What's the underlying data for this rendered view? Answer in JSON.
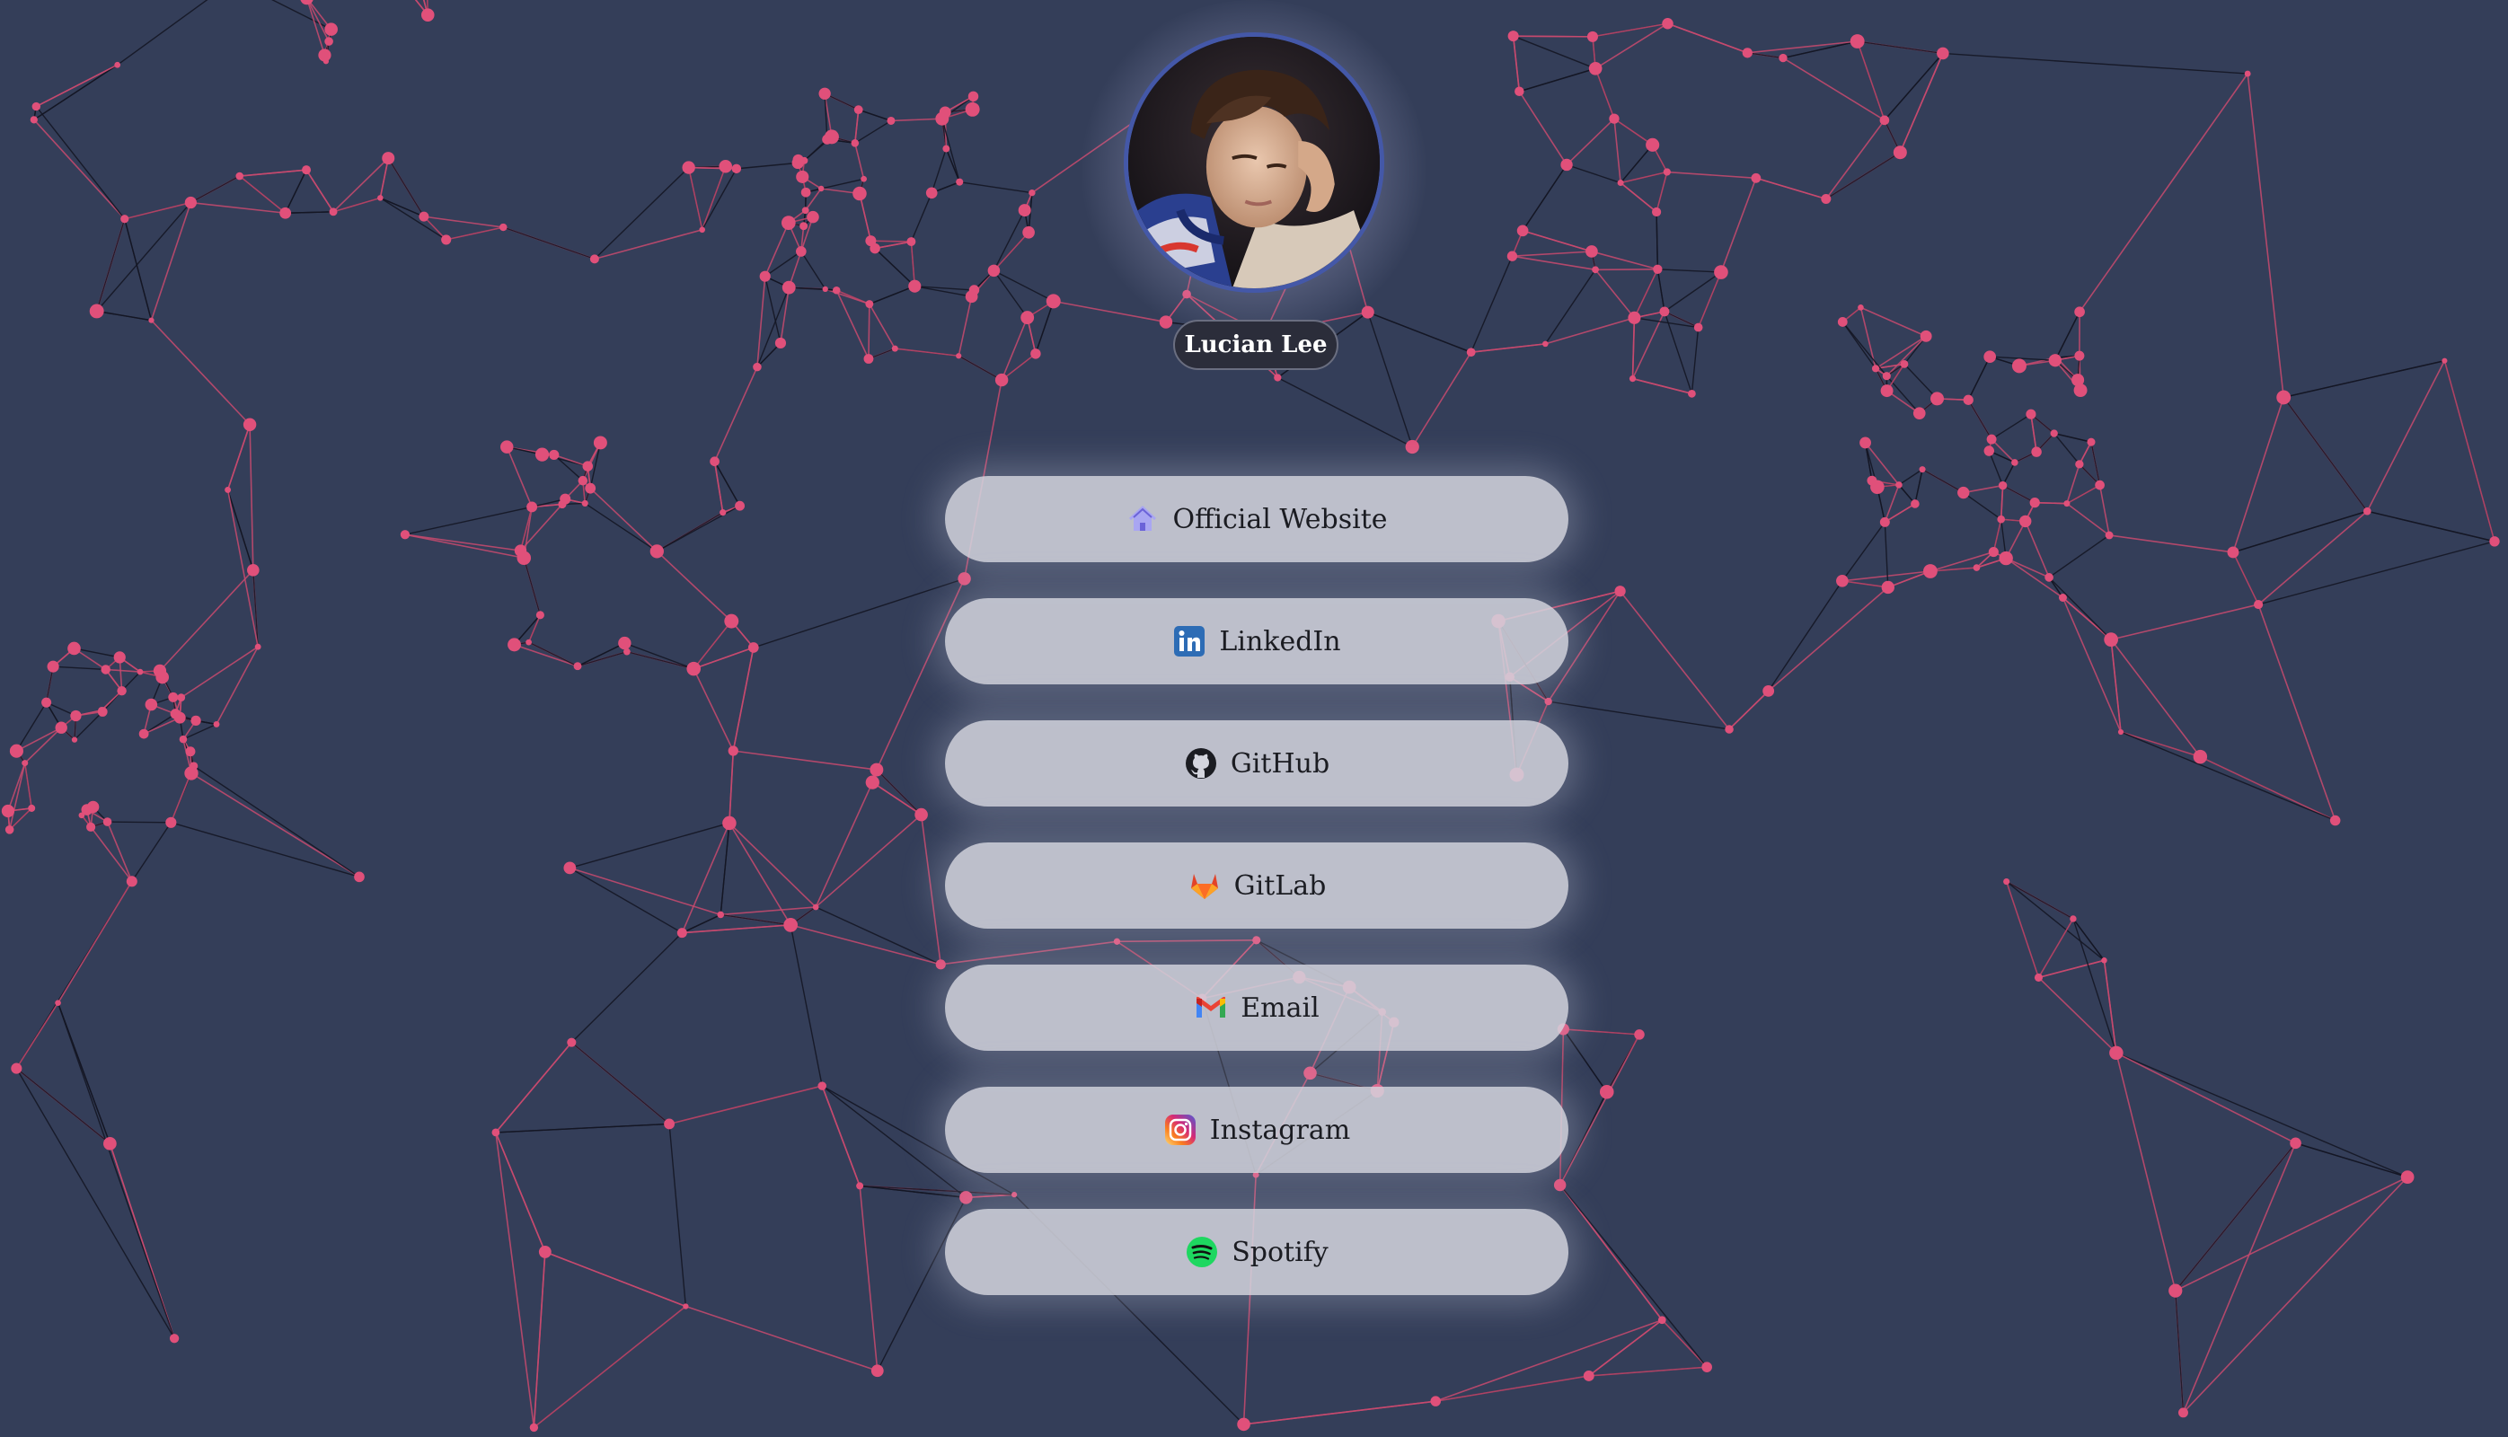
{
  "profile": {
    "name": "Lucian Lee"
  },
  "links": [
    {
      "label": "Official Website",
      "icon": "home-icon"
    },
    {
      "label": "LinkedIn",
      "icon": "linkedin-icon"
    },
    {
      "label": "GitHub",
      "icon": "github-icon"
    },
    {
      "label": "GitLab",
      "icon": "gitlab-icon"
    },
    {
      "label": "Email",
      "icon": "gmail-icon"
    },
    {
      "label": "Instagram",
      "icon": "instagram-icon"
    },
    {
      "label": "Spotify",
      "icon": "spotify-icon"
    }
  ],
  "colors": {
    "background": "#343e59",
    "network_node": "#e0507a",
    "network_line_pink": "#c94a6e",
    "network_line_dark": "#141624",
    "button_fill": "#d4d5de",
    "avatar_ring": "#4458a8"
  }
}
